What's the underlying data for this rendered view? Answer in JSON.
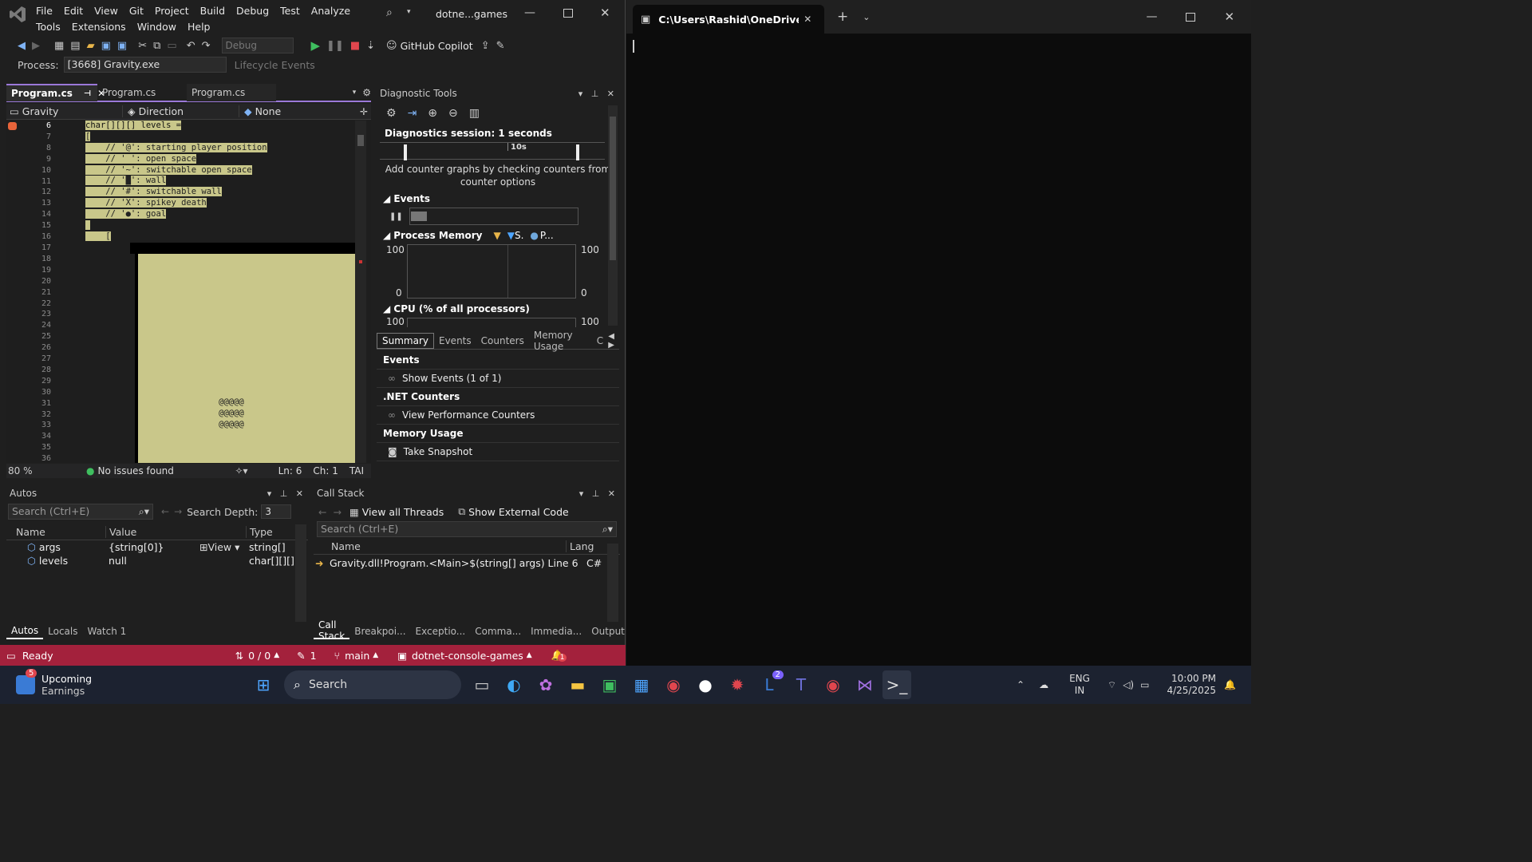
{
  "vs": {
    "menu": [
      "File",
      "Edit",
      "View",
      "Git",
      "Project",
      "Build",
      "Debug",
      "Test",
      "Analyze"
    ],
    "menu2": [
      "Tools",
      "Extensions",
      "Window",
      "Help"
    ],
    "title": "dotne...games",
    "config": "Debug",
    "copilot": "GitHub Copilot",
    "process_label": "Process:",
    "process_value": "[3668] Gravity.exe",
    "lifecycle": "Lifecycle Events",
    "tabs": [
      "Program.cs",
      "Program.cs",
      "Program.cs"
    ],
    "nav": {
      "project": "Gravity",
      "member": "Direction",
      "scope": "None"
    },
    "code": {
      "lines": [
        "6",
        "7",
        "8",
        "9",
        "10",
        "11",
        "12",
        "13",
        "14",
        "15",
        "16",
        "17",
        "18",
        "19",
        "20",
        "21",
        "22",
        "23",
        "24",
        "25",
        "26",
        "27",
        "28",
        "29",
        "30",
        "31",
        "32",
        "33",
        "34",
        "35",
        "36"
      ],
      "text": [
        "char[][][] levels =",
        "[",
        "    // '@': starting player position",
        "    // ' ': open space",
        "    // '~': switchable open space",
        "    // '█': wall",
        "    // '#': switchable wall",
        "    // 'X': spikey death",
        "    // '●': goal",
        "",
        "    [",
        "",
        "",
        "",
        "",
        "",
        "",
        "",
        "",
        "",
        "",
        "",
        "",
        "",
        "",
        "                @@@@@",
        "                @@@@@",
        "                @@@@@",
        "",
        "",
        ""
      ]
    },
    "editor_status": {
      "zoom": "80 %",
      "issues": "No issues found",
      "ln": "Ln: 6",
      "ch": "Ch: 1",
      "tab": "TAI"
    },
    "diag": {
      "title": "Diagnostic Tools",
      "session": "Diagnostics session: 1 seconds",
      "timeline_label": "10s",
      "counter_hint": "Add counter graphs by checking counters from counter options",
      "events": "Events",
      "process_memory": "Process Memory",
      "legend_s": "S.",
      "legend_p": "P...",
      "max": "100",
      "min": "0",
      "cpu": "CPU (% of all processors)",
      "tabs": [
        "Summary",
        "Events",
        "Counters",
        "Memory Usage",
        "C"
      ],
      "sections": [
        {
          "header": "Events",
          "link": "Show Events (1 of 1)"
        },
        {
          "header": ".NET Counters",
          "link": "View Performance Counters"
        },
        {
          "header": "Memory Usage",
          "link": "Take Snapshot"
        }
      ]
    },
    "autos": {
      "title": "Autos",
      "search_placeholder": "Search (Ctrl+E)",
      "depth_label": "Search Depth:",
      "depth": "3",
      "columns": [
        "Name",
        "Value",
        "Type"
      ],
      "rows": [
        {
          "name": "args",
          "value": "{string[0]}",
          "view": "View",
          "type": "string[]"
        },
        {
          "name": "levels",
          "value": "null",
          "view": "",
          "type": "char[][][]"
        }
      ],
      "tabs": [
        "Autos",
        "Locals",
        "Watch 1"
      ]
    },
    "callstack": {
      "title": "Call Stack",
      "view_threads": "View all Threads",
      "external": "Show External Code",
      "search_placeholder": "Search (Ctrl+E)",
      "columns": [
        "Name",
        "Lang"
      ],
      "rows": [
        {
          "name": "Gravity.dll!Program.<Main>$(string[] args) Line 6",
          "lang": "C#"
        }
      ],
      "tabs": [
        "Call Stack",
        "Breakpoi...",
        "Exceptio...",
        "Comma...",
        "Immedia...",
        "Output"
      ]
    },
    "status": {
      "ready": "Ready",
      "changes": "0 / 0",
      "edits": "1",
      "branch": "main",
      "repo": "dotnet-console-games",
      "notif": "1"
    }
  },
  "terminal": {
    "tab_title": "C:\\Users\\Rashid\\OneDrive\\De"
  },
  "taskbar": {
    "widget_title": "Upcoming",
    "widget_sub": "Earnings",
    "widget_badge": "5",
    "search": "Search",
    "lang1": "ENG",
    "lang2": "IN",
    "time": "10:00 PM",
    "date": "4/25/2025",
    "l_badge": "2"
  },
  "colors": {
    "accent": "#9a78d8",
    "status": "#a3213c",
    "code_hl": "#c9c78a"
  }
}
